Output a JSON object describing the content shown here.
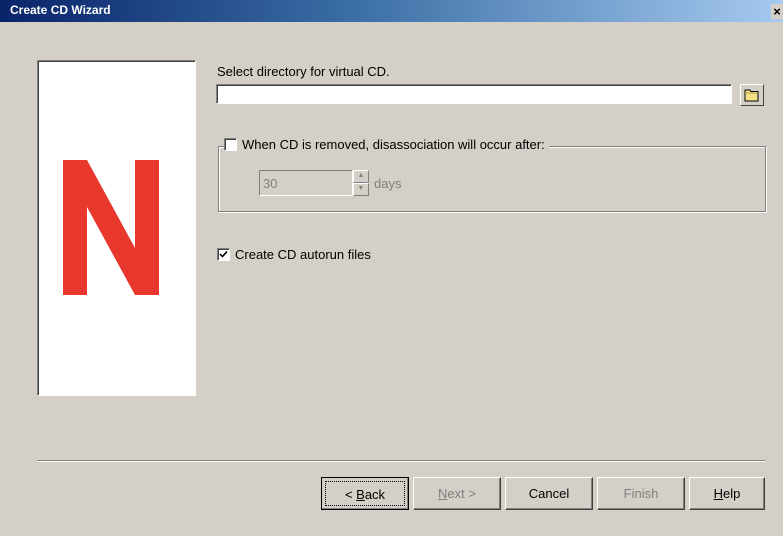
{
  "window": {
    "title": "Create CD Wizard",
    "close_label": "×"
  },
  "brand": {
    "logo_letter": "N",
    "logo_color": "#e8372c"
  },
  "directory": {
    "label": "Select directory for virtual CD.",
    "value": "",
    "browse_icon": "folder-icon"
  },
  "disassociation": {
    "checked": false,
    "label": "When CD is removed, disassociation will occur after:",
    "value": "30",
    "unit": "days",
    "enabled": false
  },
  "autorun": {
    "checked": true,
    "label": "Create CD autorun files"
  },
  "buttons": {
    "back": {
      "prefix": "< ",
      "accel": "B",
      "rest": "ack"
    },
    "next": {
      "accel": "N",
      "rest": "ext >"
    },
    "cancel": "Cancel",
    "finish": "Finish",
    "help": {
      "accel": "H",
      "rest": "elp"
    }
  },
  "colors": {
    "titlebar_start": "#0a246a",
    "titlebar_end": "#a6caf0",
    "face": "#d4d0c8"
  }
}
